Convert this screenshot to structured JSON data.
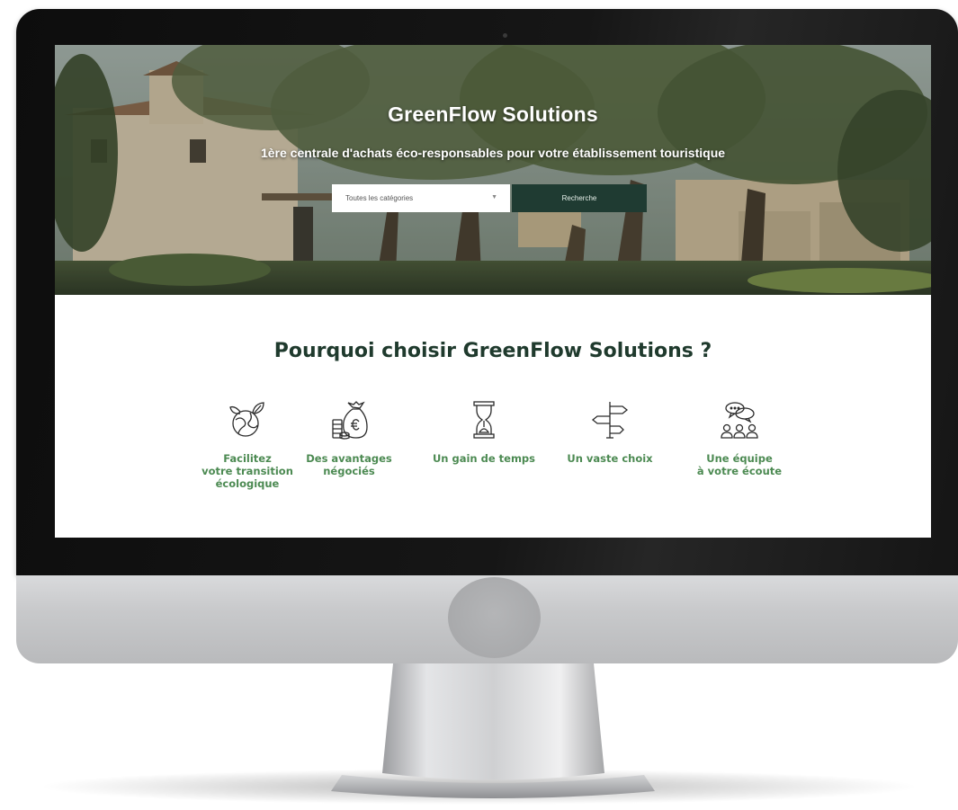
{
  "hero": {
    "title": "GreenFlow Solutions",
    "subtitle": "1ère centrale d'achats éco-responsables pour votre établissement touristique",
    "category_select": {
      "selected": "Toutes les catégories"
    },
    "search_button": "Recherche"
  },
  "why": {
    "title": "Pourquoi choisir GreenFlow Solutions ?",
    "features": [
      {
        "icon": "eco-globe-icon",
        "label": "Facilitez\nvotre transition\nécologique"
      },
      {
        "icon": "money-bag-euro-icon",
        "label": "Des avantages\nnégociés"
      },
      {
        "icon": "hourglass-icon",
        "label": "Un gain de temps"
      },
      {
        "icon": "signpost-icon",
        "label": "Un vaste choix"
      },
      {
        "icon": "team-chat-icon",
        "label": "Une équipe\nà votre écoute"
      }
    ]
  },
  "colors": {
    "accent_green": "#4c8a52",
    "dark_green": "#1f3b32",
    "title_dark": "#1f3a2d"
  }
}
